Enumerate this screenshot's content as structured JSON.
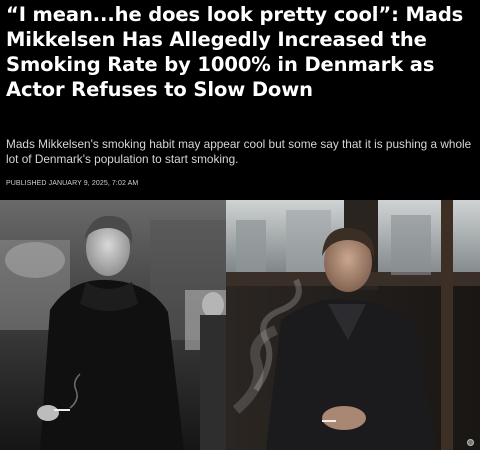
{
  "article": {
    "headline": "“I mean...he does look pretty cool”: Mads Mikkelsen Has Allegedly Increased the Smoking Rate by 1000% in Denmark as Actor Refuses to Slow Down",
    "subheadline": "Mads Mikkelsen's smoking habit may appear cool but some say that it is pushing a whole lot of Denmark's population to start smoking.",
    "dateline": "PUBLISHED JANUARY 9, 2025, 7:02 AM"
  },
  "images": {
    "left": {
      "subject": "black-and-white street photo of a man in a dark coat holding a cigarette"
    },
    "right": {
      "subject": "man in dark jacket seated by a train window holding a cigarette with smoke"
    }
  },
  "colors": {
    "background": "#000000",
    "headline": "#ffffff",
    "subheadline": "#d6d6d6"
  }
}
